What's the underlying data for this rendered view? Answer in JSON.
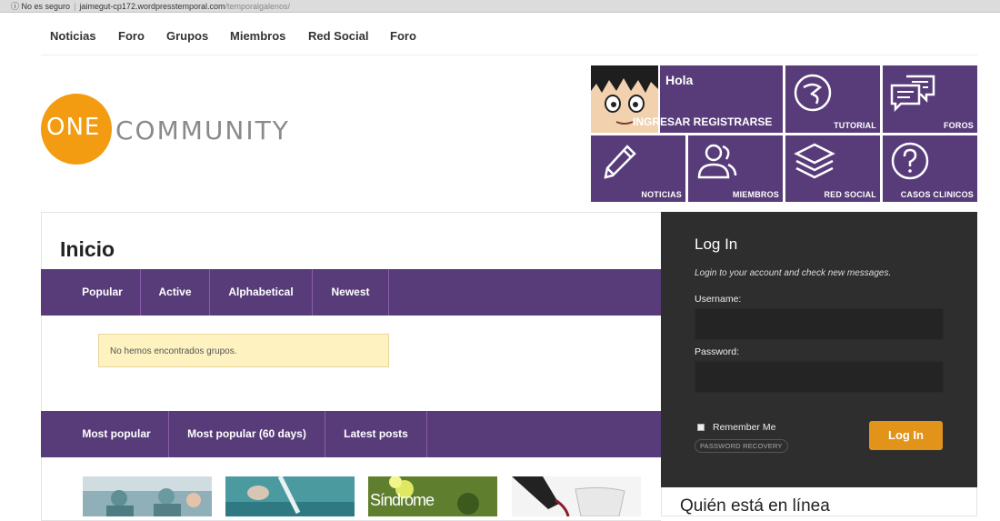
{
  "address_bar": {
    "security": "No es seguro",
    "host": "jaimegut-cp172.wordpresstemporal.com",
    "path": "/temporalgalenos/"
  },
  "top_nav": [
    "Noticias",
    "Foro",
    "Grupos",
    "Miembros",
    "Red Social",
    "Foro"
  ],
  "logo": {
    "one": "ONE",
    "community": "COMMUNITY"
  },
  "user_panel": {
    "greeting": "Hola",
    "links": "INGRESAR REGISTRARSE"
  },
  "tiles": [
    "TUTORIAL",
    "FOROS",
    "NOTICIAS",
    "MIEMBROS",
    "RED SOCIAL",
    "CASOS CLINICOS"
  ],
  "page_title": "Inicio",
  "group_tabs": [
    "Popular",
    "Active",
    "Alphabetical",
    "Newest"
  ],
  "notice": "No hemos encontrados grupos.",
  "post_tabs": [
    "Most popular",
    "Most popular (60 days)",
    "Latest posts"
  ],
  "thumbnail_caption": "Síndrome",
  "login": {
    "title": "Log In",
    "subtitle": "Login to your account and check new messages.",
    "username_label": "Username:",
    "password_label": "Password:",
    "remember": "Remember Me",
    "recovery": "PASSWORD RECOVERY",
    "button": "Log In"
  },
  "online_title": "Quién está en línea",
  "colors": {
    "accent": "#583c7a",
    "login_bg": "#2e2e2e",
    "button": "#e2931a",
    "logo": "#f39c12"
  }
}
